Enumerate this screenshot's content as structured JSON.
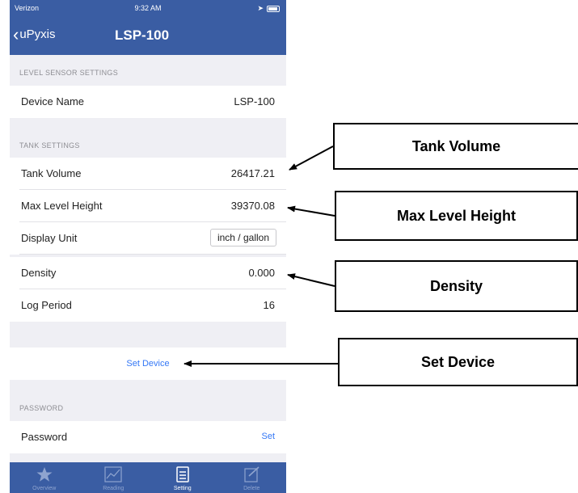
{
  "status_bar": {
    "carrier": "Verizon",
    "time": "9:32 AM"
  },
  "nav": {
    "back_label": "uPyxis",
    "title": "LSP-100"
  },
  "level_sensor_section": {
    "header": "LEVEL SENSOR SETTINGS",
    "device_name_label": "Device Name",
    "device_name_value": "LSP-100"
  },
  "tank_section": {
    "header": "TANK SETTINGS",
    "rows": [
      {
        "label": "Tank Volume",
        "value": "26417.21"
      },
      {
        "label": "Max Level Height",
        "value": "39370.08"
      },
      {
        "label": "Display Unit",
        "value": "inch / gallon"
      },
      {
        "label": "Density",
        "value": "0.000"
      },
      {
        "label": "Log Period",
        "value": "16"
      }
    ]
  },
  "set_device_label": "Set Device",
  "password_section": {
    "header": "PASSWORD",
    "label": "Password",
    "action": "Set"
  },
  "tabs": [
    {
      "label": "Overview",
      "icon": "star-icon"
    },
    {
      "label": "Reading",
      "icon": "chart-icon"
    },
    {
      "label": "Setting",
      "icon": "setting-icon"
    },
    {
      "label": "Delete",
      "icon": "delete-icon"
    }
  ],
  "callouts": {
    "tank_volume": "Tank Volume",
    "max_level_height": "Max Level Height",
    "density": "Density",
    "set_device": "Set Device"
  },
  "colors": {
    "nav_bar": "#3a5da3",
    "link": "#3478f6",
    "background": "#efeff4"
  }
}
